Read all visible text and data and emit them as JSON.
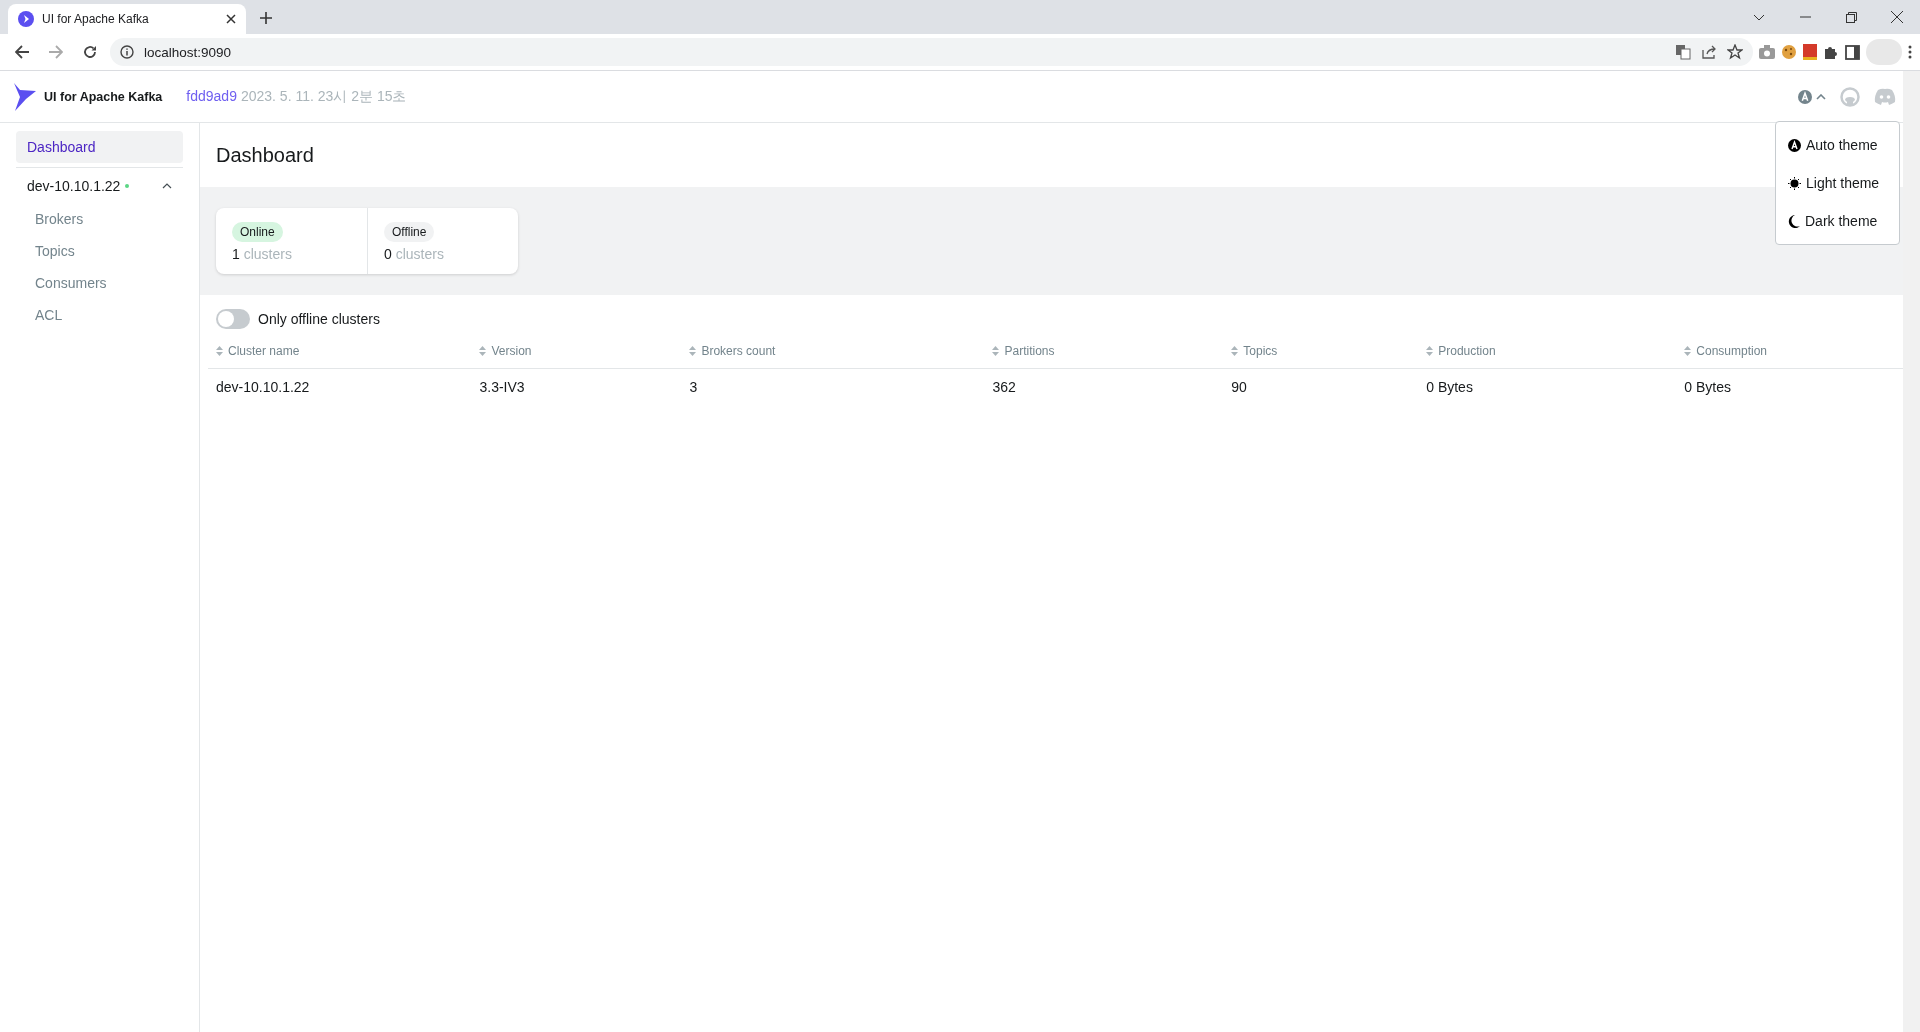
{
  "browser": {
    "tab_title": "UI for Apache Kafka",
    "url": "localhost:9090"
  },
  "header": {
    "logo_text": "UI for Apache Kafka",
    "commit": "fdd9ad9",
    "build_date": "2023. 5. 11. 23시 2분 15초"
  },
  "theme_menu": {
    "expanded": true,
    "items": [
      {
        "kind": "auto",
        "label": "Auto theme"
      },
      {
        "kind": "light",
        "label": "Light theme"
      },
      {
        "kind": "dark",
        "label": "Dark theme"
      }
    ]
  },
  "sidebar": {
    "items": [
      {
        "label": "Dashboard",
        "selected": true
      }
    ],
    "clusters": [
      {
        "name": "dev-10.10.1.22",
        "color": "#5cd685",
        "expanded": true,
        "children": [
          {
            "label": "Brokers",
            "selected": false
          },
          {
            "label": "Topics",
            "selected": false
          },
          {
            "label": "Consumers",
            "selected": false
          },
          {
            "label": "ACL",
            "selected": false
          }
        ]
      }
    ]
  },
  "page_title": "Dashboard",
  "stats": [
    {
      "kind": "online",
      "label": "Online",
      "count": "1",
      "unit": "clusters"
    },
    {
      "kind": "offline",
      "label": "Offline",
      "count": "0",
      "unit": "clusters"
    }
  ],
  "toggle": {
    "label": "Only offline clusters",
    "on": false
  },
  "table": {
    "columns": [
      "Cluster name",
      "Version",
      "Brokers count",
      "Partitions",
      "Topics",
      "Production",
      "Consumption"
    ],
    "rows": [
      [
        "dev-10.10.1.22",
        "3.3-IV3",
        "3",
        "362",
        "90",
        "0 Bytes",
        "0 Bytes"
      ]
    ]
  }
}
